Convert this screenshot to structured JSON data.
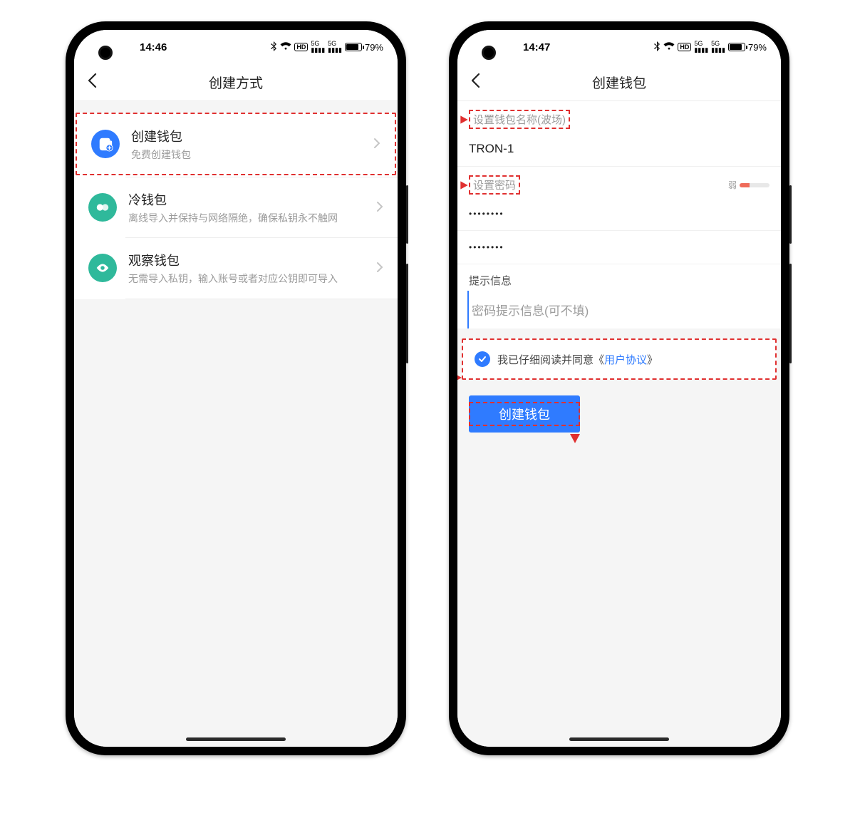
{
  "left": {
    "status": {
      "time": "14:46",
      "battery_pct": "79%"
    },
    "nav_title": "创建方式",
    "items": [
      {
        "title": "创建钱包",
        "sub": "免费创建钱包",
        "icon": "wallet-add-icon",
        "color": "bg-blue"
      },
      {
        "title": "冷钱包",
        "sub": "离线导入并保持与网络隔绝，确保私钥永不触网",
        "icon": "cold-wallet-icon",
        "color": "bg-teal"
      },
      {
        "title": "观察钱包",
        "sub": "无需导入私钥，输入账号或者对应公钥即可导入",
        "icon": "eye-icon",
        "color": "bg-teal"
      }
    ]
  },
  "right": {
    "status": {
      "time": "14:47",
      "battery_pct": "79%"
    },
    "nav_title": "创建钱包",
    "name_label": "设置钱包名称(波场)",
    "name_value": "TRON-1",
    "pwd_label": "设置密码",
    "pwd_strength_label": "弱",
    "pwd_value_mask": "••••••••",
    "pwd_confirm_mask": "••••••••",
    "hint_label": "提示信息",
    "hint_placeholder": "密码提示信息(可不填)",
    "agree_prefix": "我已仔细阅读并同意《",
    "agree_link": "用户协议",
    "agree_suffix": "》",
    "create_button": "创建钱包"
  }
}
